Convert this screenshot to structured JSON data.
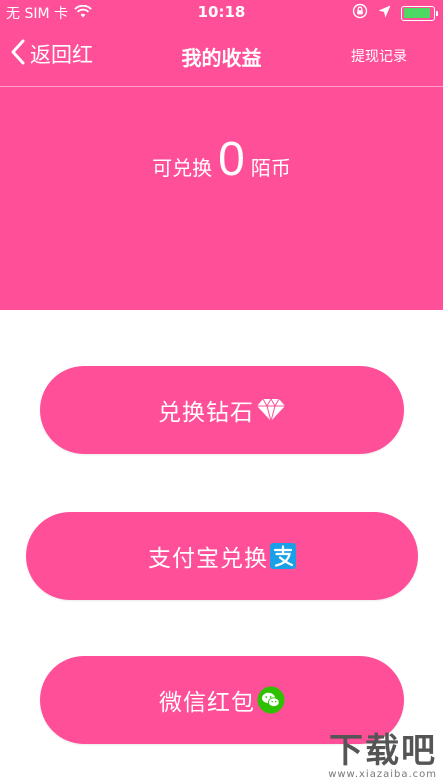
{
  "status_bar": {
    "carrier": "无 SIM 卡",
    "time": "10:18",
    "battery_level": 0.9,
    "icons": [
      "wifi-icon",
      "orientation-lock-icon",
      "location-arrow-icon",
      "battery-icon"
    ]
  },
  "nav": {
    "back_label": "返回红",
    "title": "我的收益",
    "right_label": "提现记录"
  },
  "balance": {
    "prefix": "可兑换",
    "value": "0",
    "unit": "陌币"
  },
  "actions": [
    {
      "label": "兑换钻石",
      "icon": "diamond-icon"
    },
    {
      "label": "支付宝兑换",
      "icon": "alipay-icon"
    },
    {
      "label": "微信红包",
      "icon": "wechat-icon"
    }
  ],
  "watermark": {
    "logo_text": "下载吧",
    "url": "www.xiazaiba.com"
  },
  "colors": {
    "primary_pink": "#ff4f98",
    "alipay_blue": "#1aa0e6",
    "wechat_green": "#2dc100",
    "battery_green": "#4cd964"
  }
}
